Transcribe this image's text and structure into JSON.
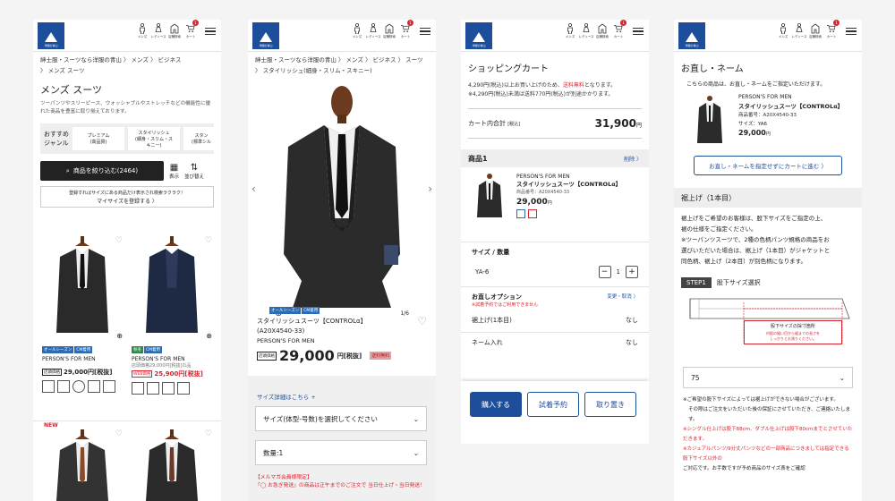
{
  "header": {
    "nav": [
      {
        "label": "メンズ"
      },
      {
        "label": "レディース"
      },
      {
        "label": "店舗検索"
      },
      {
        "label": "カート"
      }
    ],
    "cart_count": "1",
    "logo_text": "洋服の青山"
  },
  "list": {
    "breadcrumb1": "紳士服・スーツなら洋服の青山 〉 メンズ 〉 ビジネス",
    "breadcrumb2": "〉 メンズ スーツ",
    "title": "メンズ スーツ",
    "desc": "ツーパンツやスリーピース、ウォッシャブルやストレッチなどの機能性に優れた商品を豊富に取り揃えております。",
    "genre_label": "おすすめ\nジャンル",
    "genres": [
      "プレミアム\n(高品質)",
      "スタイリッシュ\n(細身・スリム・ス\nキニー)",
      "スタン\n(標準シル"
    ],
    "filter_button": "商品を絞り込む(2464)",
    "view_labels": [
      "表示",
      "並び替え"
    ],
    "mysize_text": "登録すればサイズにある商品だけ表示され検索ラクラク！",
    "mysize_link": "マイサイズを登録する 〉",
    "products": [
      {
        "tags": [
          "オールシーズン",
          "CM着用"
        ],
        "brand": "PERSON'S FOR MEN",
        "price_label": "店頭価格",
        "price": "29,000円[税抜]"
      },
      {
        "tags": [
          "秋冬",
          "CM着用"
        ],
        "brand": "PERSON'S FOR MEN",
        "note": "店頭価格29,000円[税抜]の品",
        "price_label": "WEB価格",
        "price": "25,900円[税抜]"
      }
    ],
    "new_label": "NEW"
  },
  "detail": {
    "breadcrumb1": "紳士服・スーツなら洋服の青山 〉 メンズ 〉 ビジネス 〉 スーツ",
    "breadcrumb2": "〉 スタイリッシュ(細身・スリム・スキニー)",
    "pager": "1/6",
    "tags": [
      "オールシーズン",
      "CM着用"
    ],
    "name": "スタイリッシュスーツ【CONTROLα】 (A20X4540-33)",
    "brand": "PERSON'S FOR MEN",
    "price_label": "店頭価格",
    "price": "29,000",
    "price_unit": "円[税抜]",
    "shipping_badge": "送料無料",
    "size_link": "サイズ詳細はこちら +",
    "size_select": "サイズ(体型-号数)を選択してください",
    "qty_select": "数量:1",
    "notice1": "【メルマガ会員様限定】",
    "notice2": "「◯ お急ぎ発送」の商品は正午までのご注文で 当日仕上げ・当日発送！"
  },
  "cart": {
    "title": "ショッピングカート",
    "info1": "4,290円(税込)以上お買い上げのため、",
    "info1_red": "送料無料",
    "info1_tail": "となります。",
    "info2": "※4,290円(税込)未満は送料770円(税込)が別途かかります。",
    "total_label": "カート内合計",
    "total_tax": "[税込]",
    "total_value": "31,900",
    "total_unit": "円",
    "item_header": "商品1",
    "delete_label": "削除 〉",
    "item_brand": "PERSON'S FOR MEN",
    "item_name": "スタイリッシュスーツ【CONTROLα】",
    "item_code": "商品番号：A20X4540-33",
    "item_price": "29,000",
    "item_price_unit": "円",
    "size_qty_label": "サイズ / 数量",
    "size_value": "YA-6",
    "qty_value": "1",
    "option_label": "お直しオプション",
    "option_link": "変更・取消 〉",
    "option_note": "※試着予約ではご利用できません",
    "options": [
      {
        "label": "裾上げ(1本目)",
        "value": "なし"
      },
      {
        "label": "ネーム入れ",
        "value": "なし"
      }
    ],
    "buttons": [
      "購入する",
      "試着予約",
      "取り置き"
    ]
  },
  "alter": {
    "title": "お直し・ネーム",
    "intro": "こちらの商品は、お直し・ネームをご指定いただけます。",
    "brand": "PERSON'S FOR MEN",
    "name": "スタイリッシュスーツ【CONTROLα】",
    "code": "商品番号：A20X4540-33",
    "size": "サイズ：YA6",
    "price": "29,000",
    "price_unit": "円",
    "skip_button": "お直し・ネームを指定せずにカートに進む 〉",
    "hem_title": "裾上げ（1本目）",
    "hem_text": [
      "裾上げをご希望のお客様は、股下サイズをご指定の上、",
      "裾の仕様をご指定ください。",
      "※ツーパンツスーツで、2種の色柄パンツ規格の商品をお",
      "選びいただいた場合は、裾上げ（1本目）がジャケットと",
      "同色柄、裾上げ（2本目）が別色柄になります。"
    ],
    "step_badge": "STEP1",
    "step_label": "股下サイズ選択",
    "diagram_label": "股下サイズの採寸箇所",
    "diagram_note": "内股の縫い目から裾までの長さを\nしっかりとお測りください。",
    "select_value": "75",
    "notes": [
      "※ご希望の股下サイズによっては裾上げができない場合がございます。",
      "その際はご注文をいただいた後の保証にさせていただき、ご連絡いたします。",
      "※シングル仕上げは股下88cm、ダブル仕上げは股下80cmまでとさせていただきます。",
      "※カジュアルパンツ/9分丈パンツなどの一部商品につきましては指定できる股下サイズ以外の",
      "ご対応です。お手数ですが予め商品のサイズ表をご確認"
    ]
  },
  "colors": {
    "brand": "#1d4e9c",
    "accent": "#d9232d",
    "dark": "#222222"
  }
}
